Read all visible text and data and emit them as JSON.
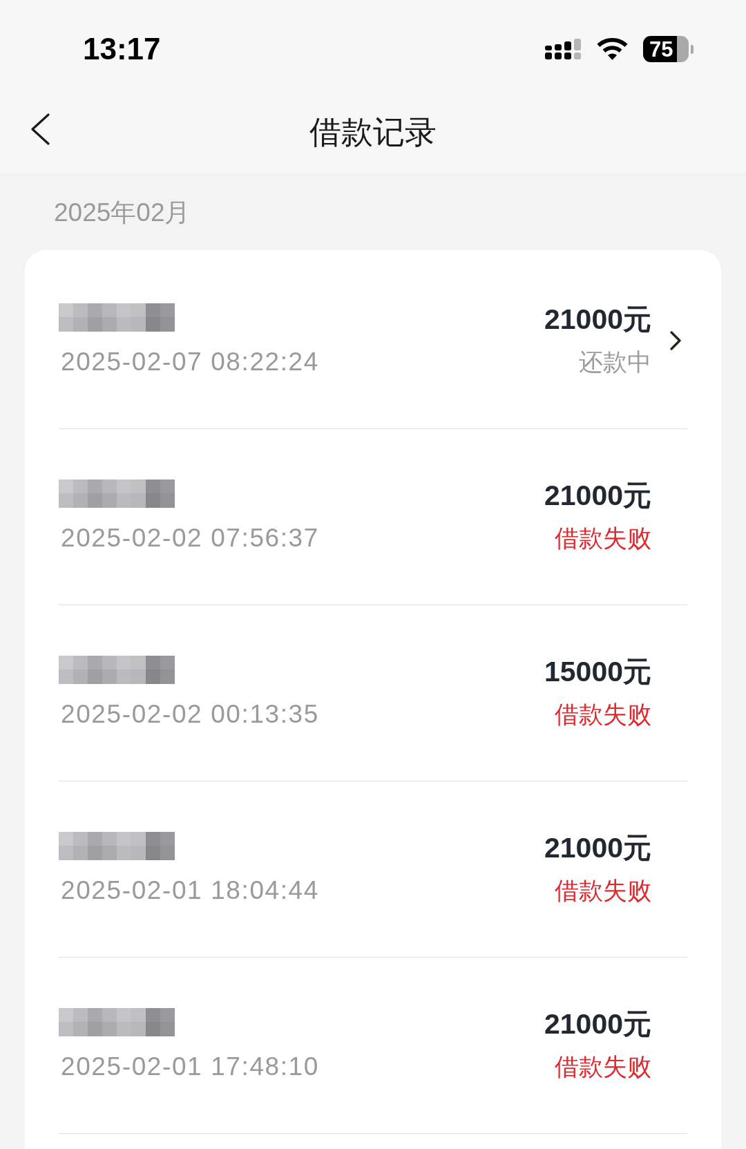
{
  "status_bar": {
    "time": "13:17",
    "battery": "75"
  },
  "nav": {
    "title": "借款记录"
  },
  "month": "2025年02月",
  "records": [
    {
      "amount": "21000元",
      "time": "2025-02-07 08:22:24",
      "status": {
        "text": "还款中",
        "kind": "repaying"
      },
      "chevron": true
    },
    {
      "amount": "21000元",
      "time": "2025-02-02 07:56:37",
      "status": {
        "text": "借款失败",
        "kind": "failed"
      },
      "chevron": false
    },
    {
      "amount": "15000元",
      "time": "2025-02-02 00:13:35",
      "status": {
        "text": "借款失败",
        "kind": "failed"
      },
      "chevron": false
    },
    {
      "amount": "21000元",
      "time": "2025-02-01 18:04:44",
      "status": {
        "text": "借款失败",
        "kind": "failed"
      },
      "chevron": false
    },
    {
      "amount": "21000元",
      "time": "2025-02-01 17:48:10",
      "status": {
        "text": "借款失败",
        "kind": "failed"
      },
      "chevron": false
    }
  ]
}
